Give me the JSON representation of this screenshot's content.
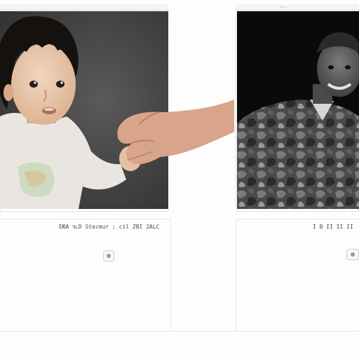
{
  "panels": [
    {
      "caption": "EЮA ℡D Stecmur ; cil ZBI 2ALC",
      "topbar_mark": "",
      "photo_subject": "toddler-portrait"
    },
    {
      "caption": "I B II II II",
      "topbar_mark": "~~~",
      "photo_subject": "soldier-portrait"
    }
  ],
  "icons": {
    "left_control": "photo-control-icon",
    "right_control": "photo-control-icon"
  },
  "colors": {
    "left_background": "#4a4a4a",
    "right_background": "#0a0a0a",
    "frame_border": "#e2e2e2"
  }
}
